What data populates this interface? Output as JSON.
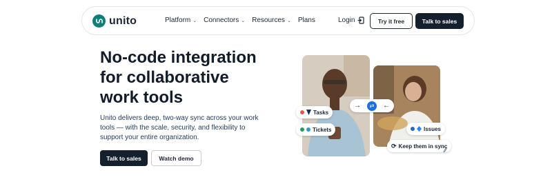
{
  "nav": {
    "logo_text": "unito",
    "menu": [
      {
        "label": "Platform",
        "dropdown": true
      },
      {
        "label": "Connectors",
        "dropdown": true
      },
      {
        "label": "Resources",
        "dropdown": true
      },
      {
        "label": "Plans",
        "dropdown": false
      }
    ],
    "login_label": "Login",
    "try_label": "Try it free",
    "sales_label": "Talk to sales"
  },
  "hero": {
    "title_line1": "No-code integration",
    "title_line2": "for collaborative",
    "title_line3": "work tools",
    "desc_line1": "Unito delivers deep, two-way sync across your work",
    "desc_line2": "tools — with the scale, security, and flexibility to",
    "desc_line3": "support your entire organization.",
    "cta_sales": "Talk to sales",
    "cta_demo": "Watch demo"
  },
  "visual": {
    "chip_tasks": "Tasks",
    "chip_tickets": "Tickets",
    "chip_issues": "Issues",
    "chip_sync": "Keep them in sync",
    "sync_left_arrow": "→",
    "sync_center": "⇄",
    "sync_right_arrow": "←"
  },
  "colors": {
    "brand": "#0d7f7a",
    "dark_button": "#15202e",
    "sync_blue": "#1d6fe0"
  }
}
